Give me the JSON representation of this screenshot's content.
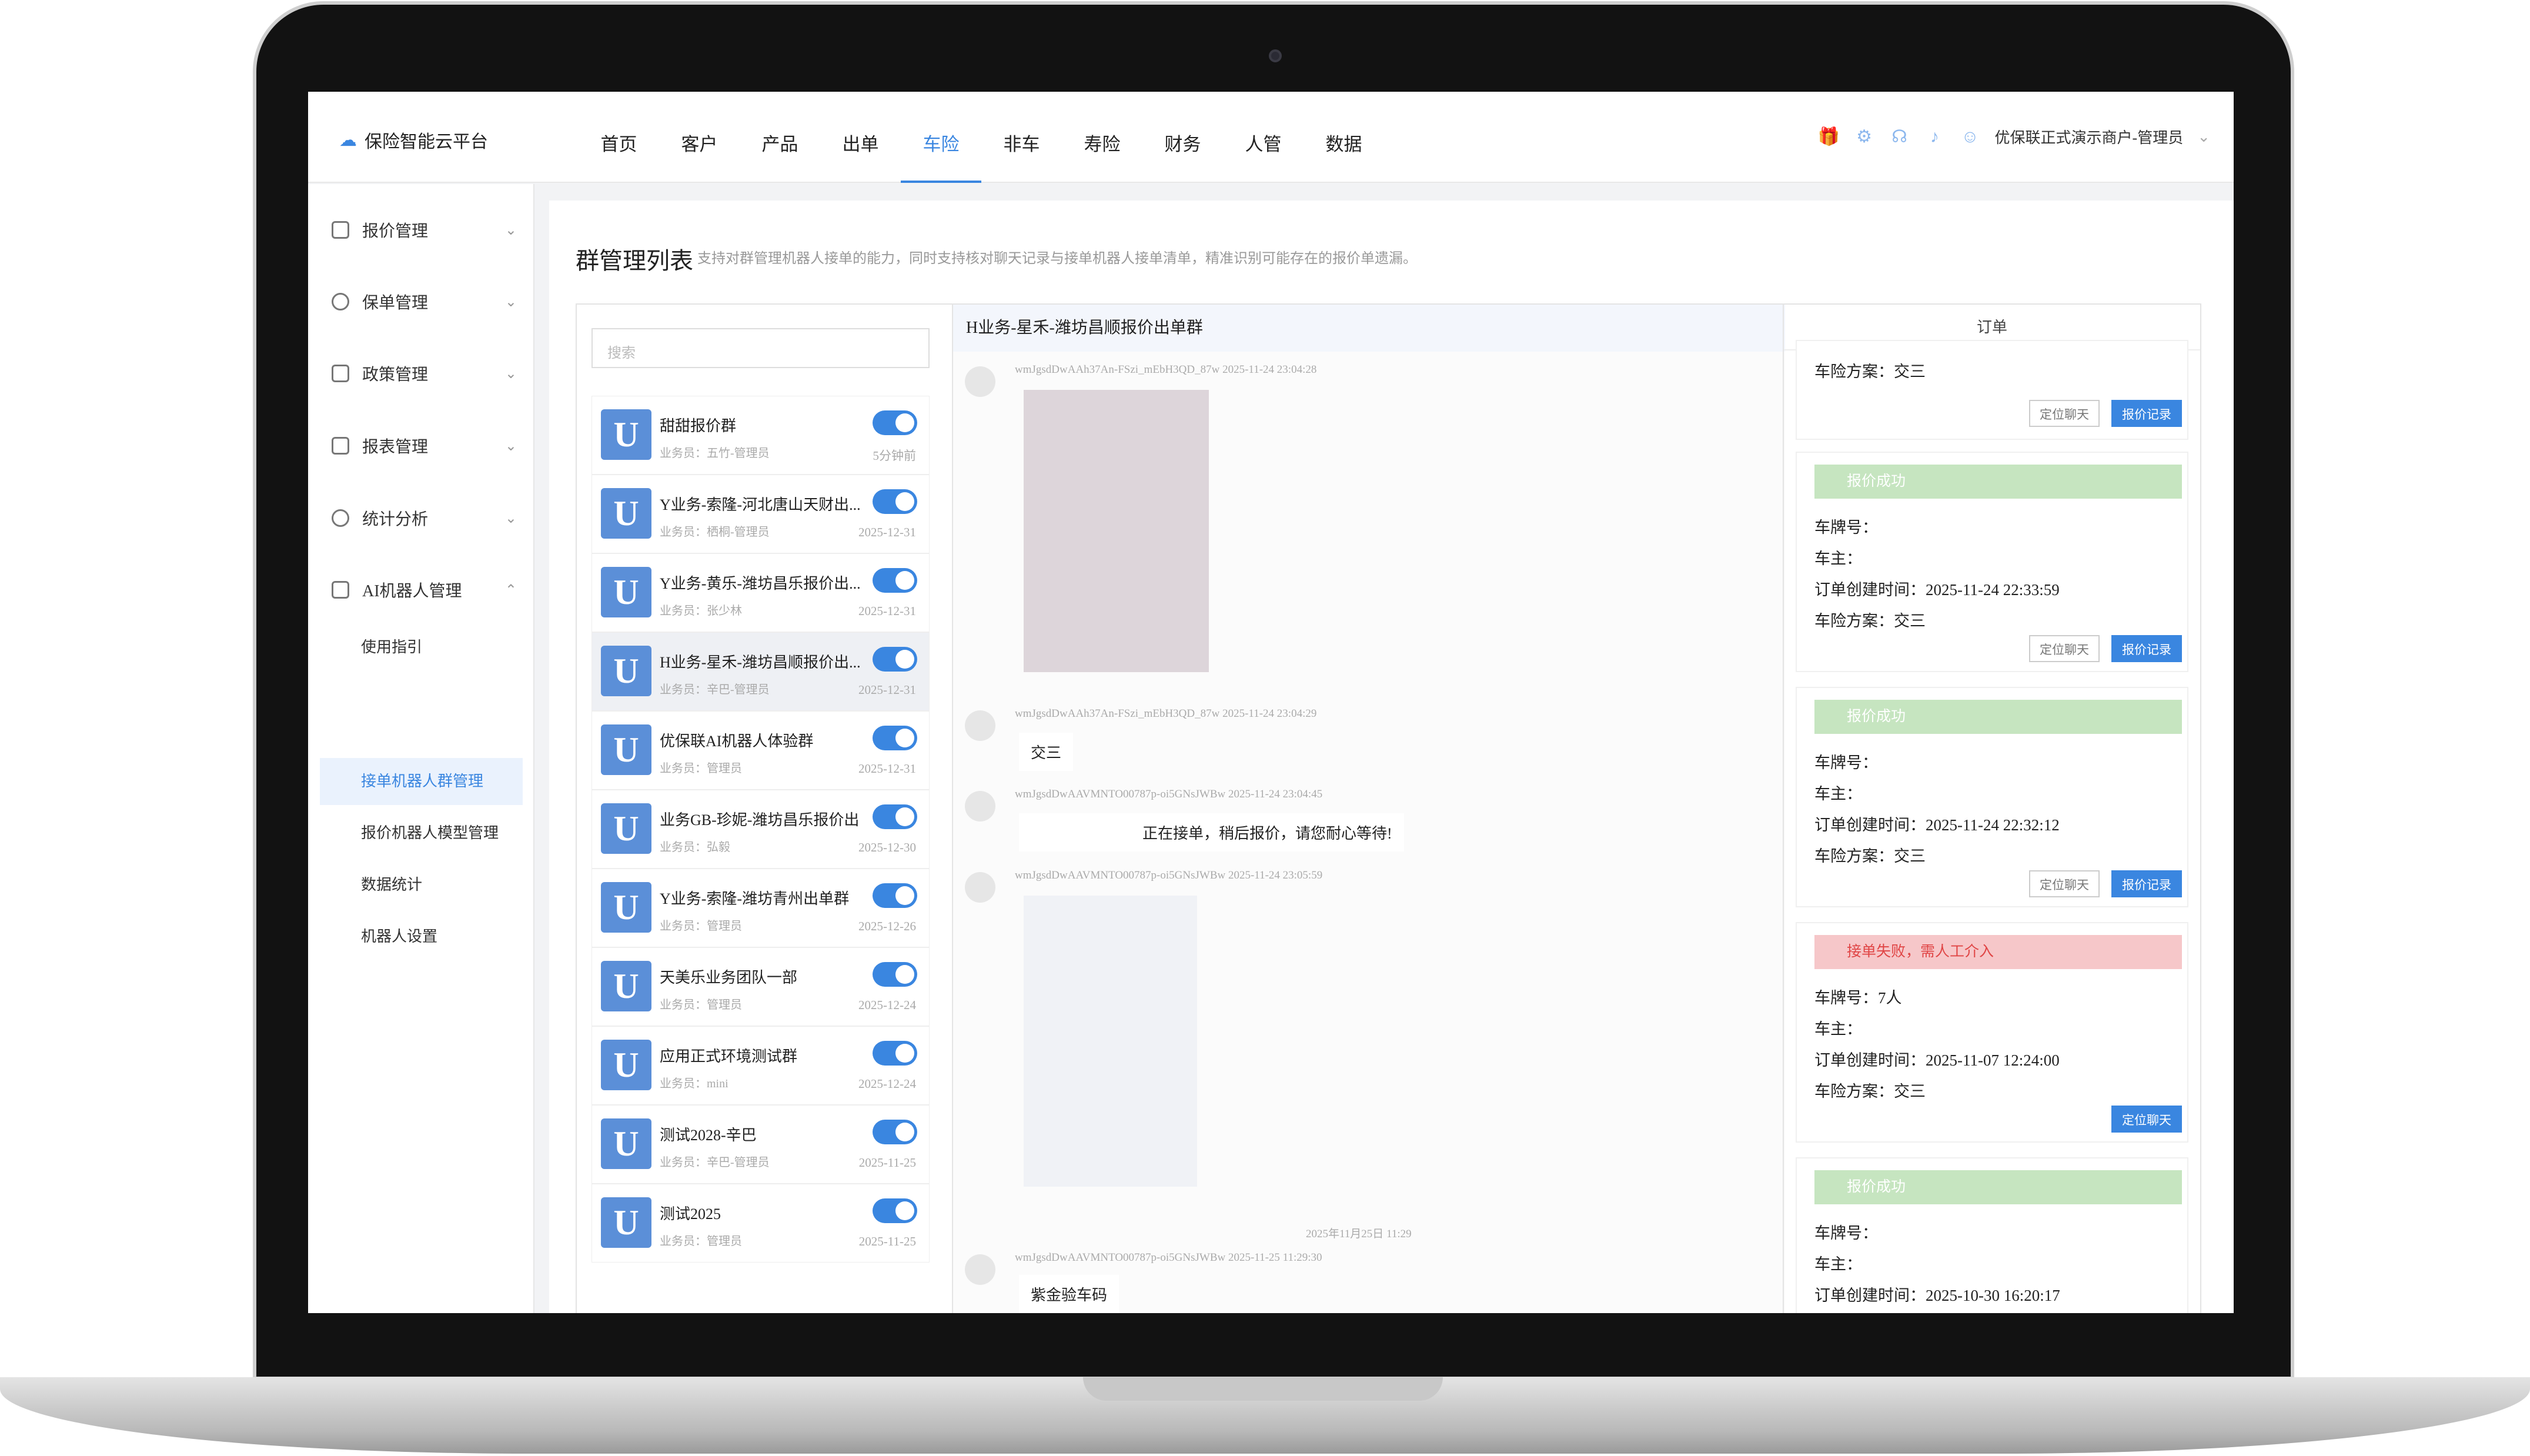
{
  "app": {
    "name": "保险智能云平台"
  },
  "nav": {
    "items": [
      "首页",
      "客户",
      "产品",
      "出单",
      "车险",
      "非车",
      "寿险",
      "财务",
      "人管",
      "数据"
    ]
  },
  "user": {
    "label": "优保联正式演示商户-管理员"
  },
  "sidebar": {
    "items": [
      "报价管理",
      "保单管理",
      "政策管理",
      "报表管理",
      "统计分析",
      "AI机器人管理"
    ],
    "sub_items": [
      "使用指引",
      "接单机器人群管理",
      "报价机器人模型管理",
      "数据统计",
      "机器人设置"
    ]
  },
  "page": {
    "title": "群管理列表",
    "desc": "支持对群管理机器人接单的能力，同时支持核对聊天记录与接单机器人接单清单，精准识别可能存在的报价单遗漏。"
  },
  "search": {
    "placeholder": "搜索"
  },
  "groups": [
    {
      "name": "甜甜报价群",
      "sub": "业务员：五竹-管理员",
      "date": "5分钟前"
    },
    {
      "name": "Y业务-索隆-河北唐山天财出...",
      "sub": "业务员：栖桐-管理员",
      "date": "2025-12-31"
    },
    {
      "name": "Y业务-黄乐-潍坊昌乐报价出...",
      "sub": "业务员：张少林",
      "date": "2025-12-31"
    },
    {
      "name": "H业务-星禾-潍坊昌顺报价出...",
      "sub": "业务员：辛巴-管理员",
      "date": "2025-12-31"
    },
    {
      "name": "优保联AI机器人体验群",
      "sub": "业务员：管理员",
      "date": "2025-12-31"
    },
    {
      "name": "业务GB-珍妮-潍坊昌乐报价出...",
      "sub": "业务员：弘毅",
      "date": "2025-12-30"
    },
    {
      "name": "Y业务-索隆-潍坊青州出单群",
      "sub": "业务员：管理员",
      "date": "2025-12-26"
    },
    {
      "name": "天美乐业务团队一部",
      "sub": "业务员：管理员",
      "date": "2025-12-24"
    },
    {
      "name": "应用正式环境测试群",
      "sub": "业务员：mini",
      "date": "2025-12-24"
    },
    {
      "name": "测试2028-辛巴",
      "sub": "业务员：辛巴-管理员",
      "date": "2025-11-25"
    },
    {
      "name": "测试2025",
      "sub": "业务员：管理员",
      "date": "2025-11-25"
    }
  ],
  "chat": {
    "title": "H业务-星禾-潍坊昌顺报价出单群",
    "messages": [
      {
        "meta": "wmJgsdDwAAh37An-FSzi_mEbH3QD_87w    2025-11-24 23:04:28",
        "text": ""
      },
      {
        "meta": "wmJgsdDwAAh37An-FSzi_mEbH3QD_87w    2025-11-24 23:04:29",
        "text": "交三"
      },
      {
        "meta": "wmJgsdDwAAVMNTO00787p-oi5GNsJWBw    2025-11-24 23:04:45",
        "text": "正在接单，稍后报价，请您耐心等待!"
      },
      {
        "meta": "wmJgsdDwAAVMNTO00787p-oi5GNsJWBw    2025-11-24 23:05:59",
        "text": ""
      },
      {
        "meta": "wmJgsdDwAAVMNTO00787p-oi5GNsJWBw    2025-11-25 11:29:30",
        "text": "紫金验车码"
      }
    ],
    "date_divider": "2025年11月25日 11:29"
  },
  "orders": {
    "header": "订单",
    "labels": {
      "plate": "车牌号：",
      "owner": "车主：",
      "created": "订单创建时间：",
      "plan": "车险方案："
    },
    "btn_locate": "定位聊天",
    "btn_quote": "报价记录",
    "items": [
      {
        "status": "",
        "plate": "",
        "created": "",
        "plan": "交三"
      },
      {
        "status": "报价成功",
        "plate": "",
        "created": "2025-11-24 22:33:59",
        "plan": "交三"
      },
      {
        "status": "报价成功",
        "plate": "",
        "created": "2025-11-24 22:32:12",
        "plan": "交三"
      },
      {
        "status": "接单失败，需人工介入",
        "plate": "7人",
        "created": "2025-11-07 12:24:00",
        "plan": "交三"
      },
      {
        "status": "报价成功",
        "plate": "",
        "created": "2025-10-30 16:20:17",
        "plan": ""
      }
    ]
  }
}
